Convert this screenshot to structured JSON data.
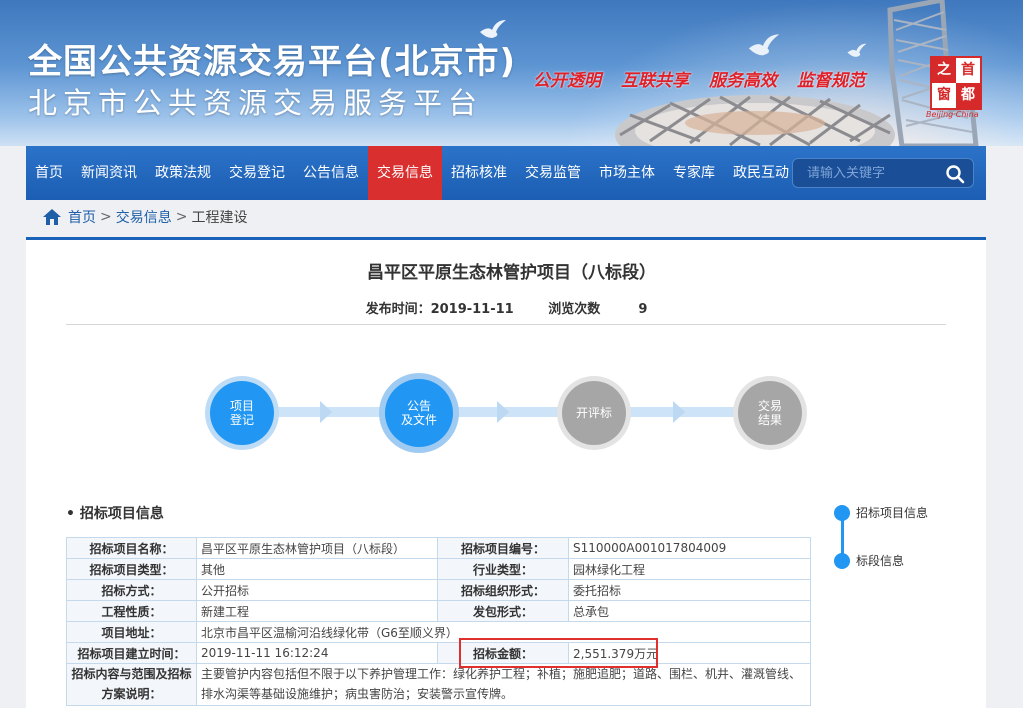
{
  "header": {
    "title_main": "全国公共资源交易平台(北京市)",
    "title_sub": "北京市公共资源交易服务平台",
    "slogans": [
      "公开透明",
      "互联共享",
      "服务高效",
      "监督规范"
    ],
    "seal_chars": [
      "之",
      "首",
      "窗",
      "都"
    ],
    "seal_latin": "Beijing·China"
  },
  "nav": {
    "items": [
      "首页",
      "新闻资讯",
      "政策法规",
      "交易登记",
      "公告信息",
      "交易信息",
      "招标核准",
      "交易监管",
      "市场主体",
      "专家库",
      "政民互动"
    ],
    "active": "交易信息",
    "search_placeholder": "请输入关键字"
  },
  "breadcrumb": {
    "home": "首页",
    "sep": ">",
    "level1": "交易信息",
    "level2": "工程建设"
  },
  "doc": {
    "title": "昌平区平原生态林管护项目（八标段）",
    "publish_label": "发布时间：2019-11-11",
    "views_label": "浏览次数",
    "views_value": "9"
  },
  "steps": [
    {
      "label": "项目\n登记",
      "state": "done"
    },
    {
      "label": "公告\n及文件",
      "state": "current"
    },
    {
      "label": "开评标",
      "state": "pending"
    },
    {
      "label": "交易\n结果",
      "state": "pending"
    }
  ],
  "section_title": "• 招标项目信息",
  "table": {
    "rows": [
      [
        "招标项目名称：",
        "昌平区平原生态林管护项目（八标段）",
        "招标项目编号：",
        "S110000A001017804009"
      ],
      [
        "招标项目类型：",
        "其他",
        "行业类型：",
        "园林绿化工程"
      ],
      [
        "招标方式：",
        "公开招标",
        "招标组织形式：",
        "委托招标"
      ],
      [
        "工程性质：",
        "新建工程",
        "发包形式：",
        "总承包"
      ]
    ],
    "address_label": "项目地址：",
    "address_value": "北京市昌平区温榆河沿线绿化带（G6至顺义界）",
    "created_label": "招标项目建立时间：",
    "created_value": "2019-11-11 16:12:24",
    "amount_label": "招标金额：",
    "amount_value": "2,551.379万元",
    "scope_label": "招标内容与范围及招标方案说明：",
    "scope_value": "主要管护内容包括但不限于以下养护管理工作：绿化养护工程；补植；施肥追肥；道路、围栏、机井、灌溉管线、排水沟渠等基础设施维护；病虫害防治；安装警示宣传牌。"
  },
  "side_nav": [
    "招标项目信息",
    "标段信息"
  ],
  "colors": {
    "nav_bg": "#1c5eb3",
    "active": "#d92f2f",
    "step_blue": "#2196f3",
    "step_gray": "#a6a6a6",
    "highlight": "#e0302e"
  }
}
